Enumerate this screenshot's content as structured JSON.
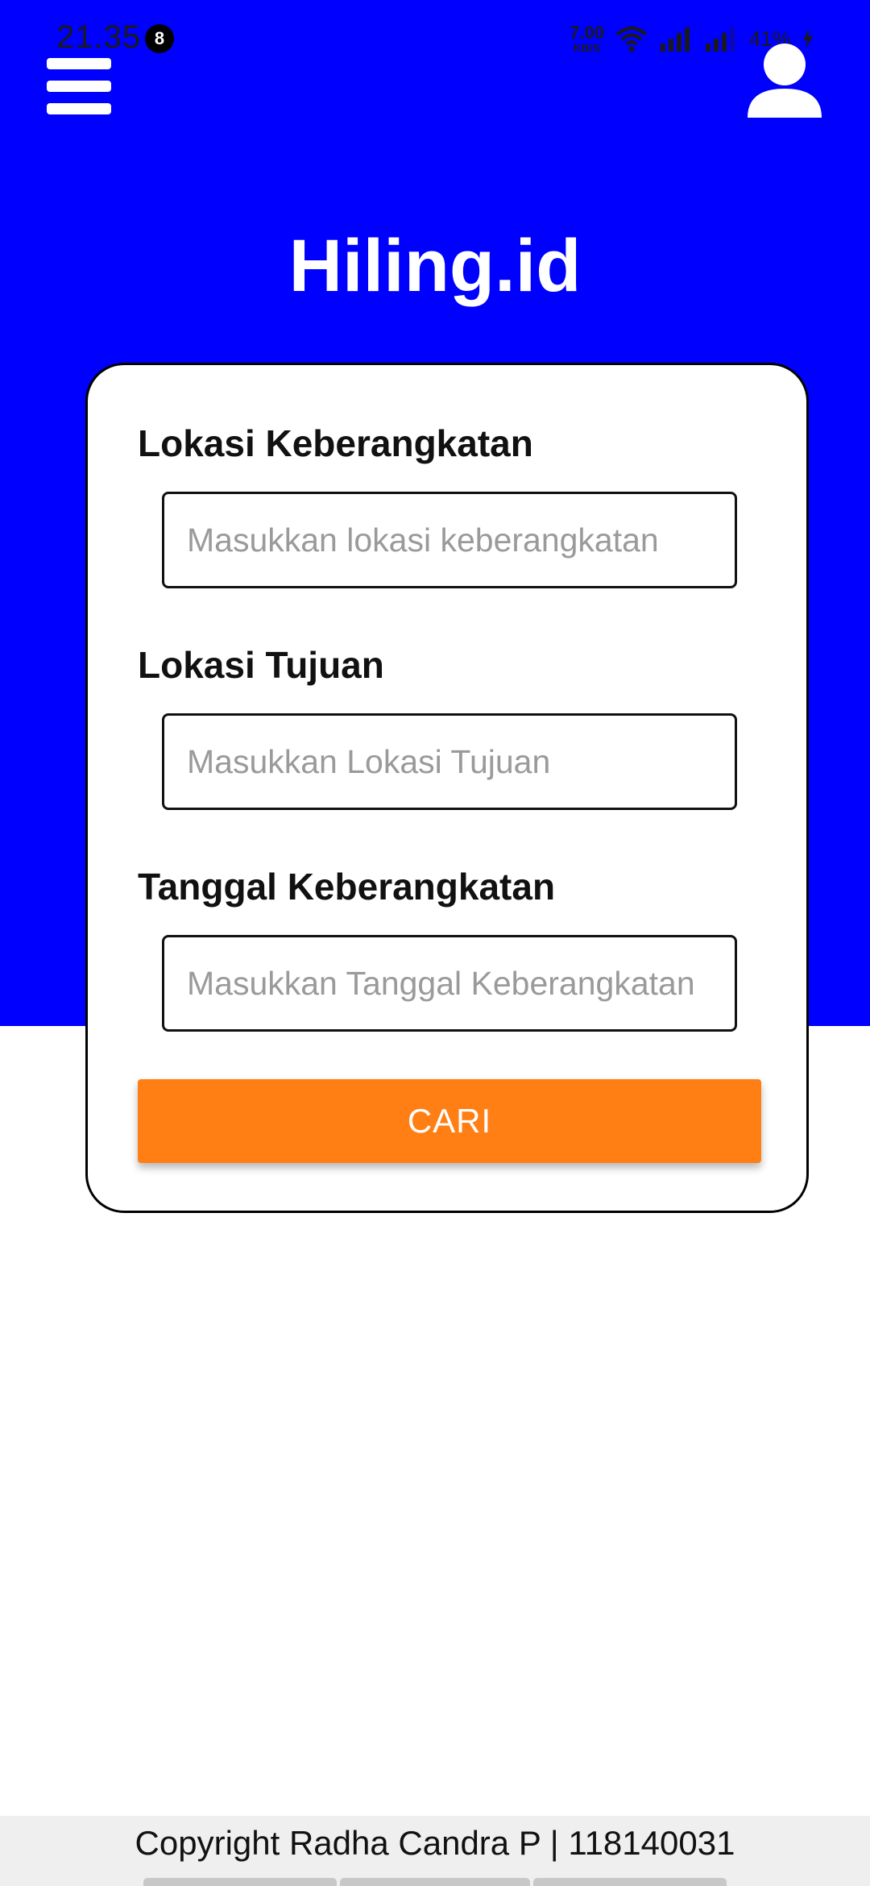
{
  "status_bar": {
    "time": "21.35",
    "notification_count": "8",
    "net_speed_value": "7.00",
    "net_speed_unit": "KB/S",
    "battery": "41%"
  },
  "header": {
    "menu_icon": "hamburger-menu-icon",
    "account_icon": "user-account-icon",
    "title": "Hiling.id"
  },
  "form": {
    "departure": {
      "label": "Lokasi Keberangkatan",
      "placeholder": "Masukkan lokasi keberangkatan",
      "value": ""
    },
    "destination": {
      "label": "Lokasi Tujuan",
      "placeholder": "Masukkan Lokasi Tujuan",
      "value": ""
    },
    "date": {
      "label": "Tanggal Keberangkatan",
      "placeholder": "Masukkan Tanggal Keberangkatan",
      "value": ""
    },
    "search_button": "CARI"
  },
  "footer": {
    "copyright": "Copyright Radha Candra P | 118140031"
  },
  "colors": {
    "hero_background": "#0000ff",
    "button_accent": "#ff7f15",
    "footer_background": "#efefef"
  }
}
